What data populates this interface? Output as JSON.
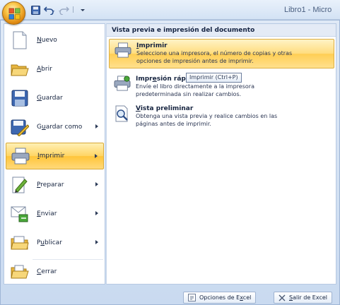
{
  "window": {
    "title": "Libro1 - Micro",
    "qat_separator": "|"
  },
  "left_menu": {
    "items": [
      {
        "key": "nuevo",
        "label_pre": "",
        "label_mn": "N",
        "label_post": "uevo",
        "submenu": false
      },
      {
        "key": "abrir",
        "label_pre": "",
        "label_mn": "A",
        "label_post": "brir",
        "submenu": false
      },
      {
        "key": "guardar",
        "label_pre": "",
        "label_mn": "G",
        "label_post": "uardar",
        "submenu": false
      },
      {
        "key": "guardar-como",
        "label_pre": "G",
        "label_mn": "u",
        "label_post": "ardar como",
        "submenu": true
      },
      {
        "key": "imprimir",
        "label_pre": "",
        "label_mn": "I",
        "label_post": "mprimir",
        "submenu": true,
        "active": true
      },
      {
        "key": "preparar",
        "label_pre": "",
        "label_mn": "P",
        "label_post": "reparar",
        "submenu": true
      },
      {
        "key": "enviar",
        "label_pre": "",
        "label_mn": "E",
        "label_post": "nviar",
        "submenu": true
      },
      {
        "key": "publicar",
        "label_pre": "P",
        "label_mn": "u",
        "label_post": "blicar",
        "submenu": true
      },
      {
        "key": "cerrar",
        "label_pre": "",
        "label_mn": "C",
        "label_post": "errar",
        "submenu": false
      }
    ]
  },
  "print_panel": {
    "header": "Vista previa e impresión del documento",
    "options": [
      {
        "key": "imprimir",
        "title_pre": "",
        "title_mn": "I",
        "title_post": "mprimir",
        "desc": [
          "Seleccione una impresora, el número de copias y otras",
          "opciones de impresión antes de imprimir."
        ],
        "active": true
      },
      {
        "key": "impresion-rapida",
        "title_pre": "Impr",
        "title_mn": "e",
        "title_post": "sión rápid",
        "desc": [
          "Envíe el libro directamente a la impresora",
          "predeterminada sin realizar cambios."
        ],
        "active": false
      },
      {
        "key": "vista-preliminar",
        "title_pre": "",
        "title_mn": "V",
        "title_post": "ista preliminar",
        "desc": [
          "Obtenga una vista previa y realice cambios en las",
          "páginas antes de imprimir."
        ],
        "active": false
      }
    ],
    "tooltip": "Imprimir (Ctrl+P)"
  },
  "footer": {
    "options_pre": "Opciones de E",
    "options_mn": "x",
    "options_post": "cel",
    "exit_pre": "",
    "exit_mn": "S",
    "exit_post": "alir de Excel"
  },
  "colors": {
    "active_gradient_top": "#fff0b5",
    "active_gradient_bottom": "#ffc53a",
    "frame_blue": "#c9daf0"
  }
}
